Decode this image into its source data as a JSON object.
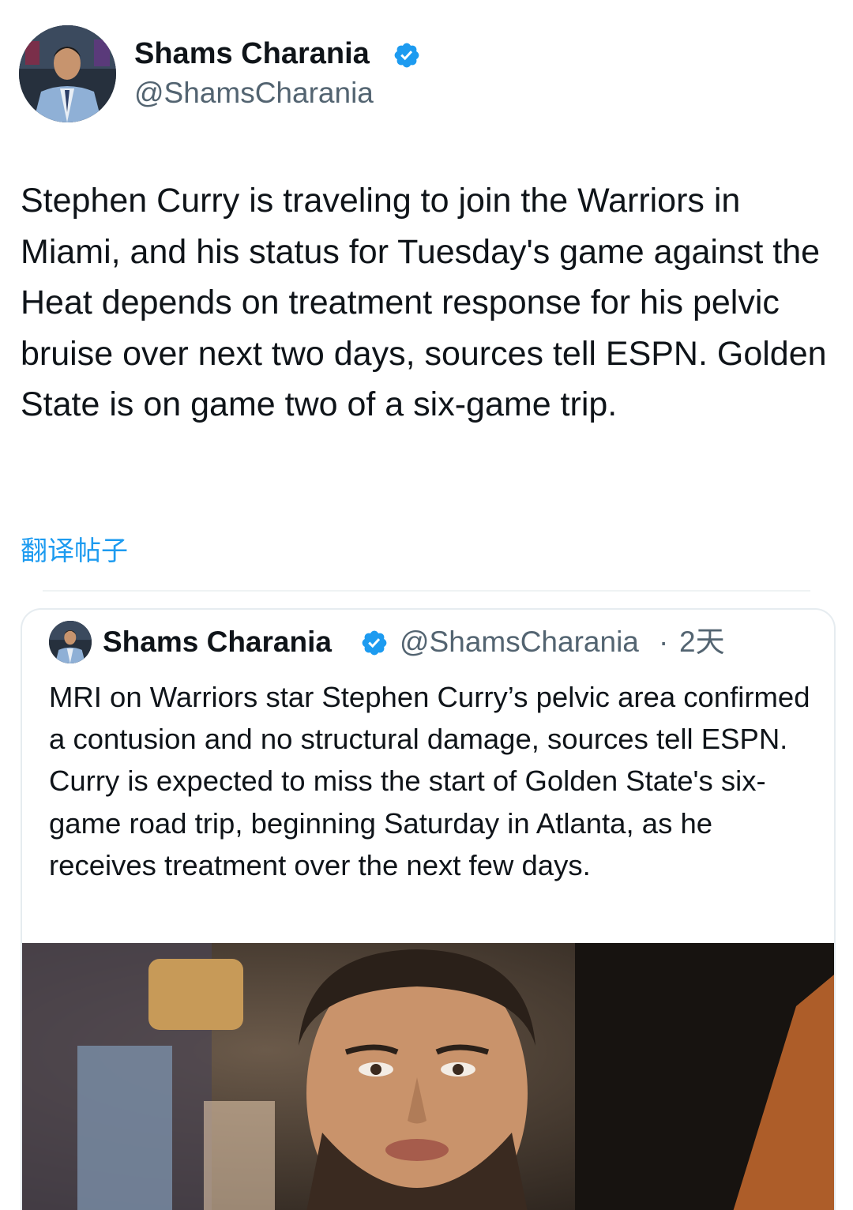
{
  "author": {
    "display_name": "Shams Charania",
    "handle": "@ShamsCharania",
    "verified_icon": "verified-badge-icon",
    "avatar_icon": "avatar-photo"
  },
  "tweet": {
    "text": "Stephen Curry is traveling to join the Warriors in Miami, and his status for Tuesday's game against the Heat depends on treatment response for his pelvic bruise over next two days, sources tell ESPN. Golden State is on game two of a six-game trip."
  },
  "translate_label": "翻译帖子",
  "quoted": {
    "display_name": "Shams Charania",
    "handle": "@ShamsCharania",
    "separator": "·",
    "time": "2天",
    "text": "MRI on Warriors star Stephen Curry’s pelvic area confirmed a contusion and no structural damage, sources tell ESPN. Curry is expected to miss the start of Golden State's six-game road trip, beginning Saturday in Atlanta, as he receives treatment over the next few days.",
    "media_icon": "player-photo"
  },
  "colors": {
    "link": "#1d9bf0",
    "verified": "#1d9bf0",
    "secondary_text": "#536471",
    "primary_text": "#0f1419"
  }
}
